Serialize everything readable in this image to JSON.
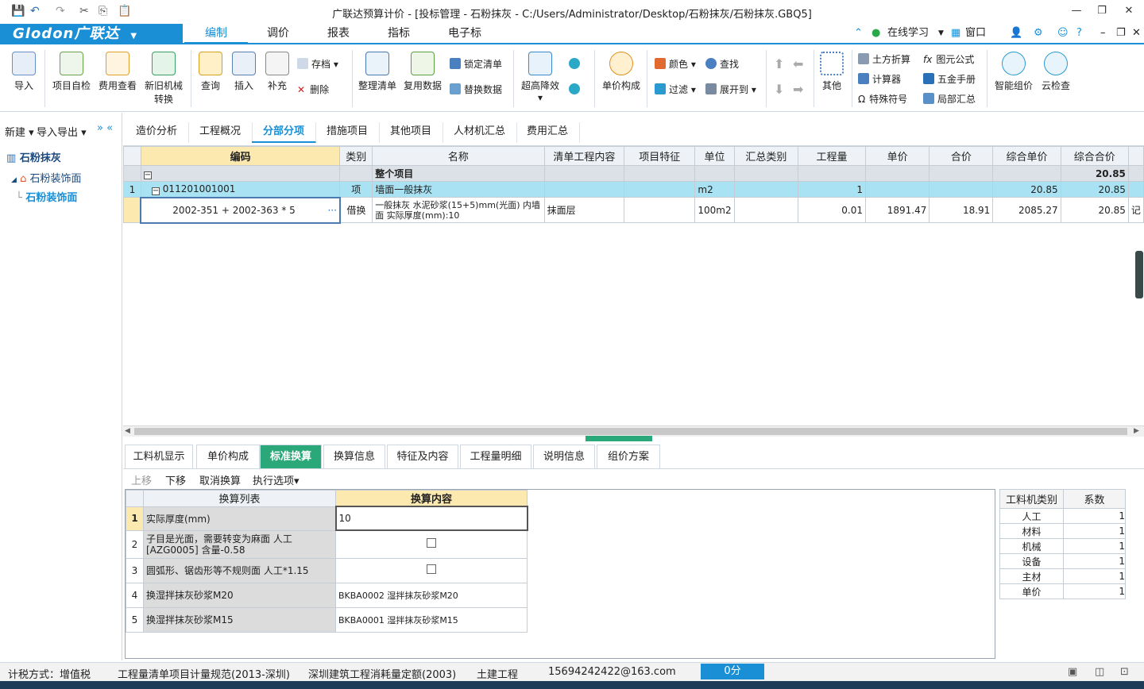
{
  "window": {
    "title": "广联达预算计价 - [投标管理 - 石粉抹灰 - C:/Users/Administrator/Desktop/石粉抹灰/石粉抹灰.GBQ5]",
    "minimize": "—",
    "restore": "❐",
    "close": "✕"
  },
  "menu": {
    "logo": "Glodon广联达",
    "tabs": [
      "编制",
      "调价",
      "报表",
      "指标",
      "电子标"
    ],
    "online_learning": "在线学习",
    "window": "窗口"
  },
  "ribbon": {
    "import": "导入",
    "project_check": "项目自检",
    "fee_view": "费用查看",
    "convert_line1": "新旧机械",
    "convert_line2": "转换",
    "query": "查询",
    "insert": "插入",
    "supplement": "补充",
    "archive": "存档",
    "delete": "删除",
    "organize": "整理清单",
    "reuse": "复用数据",
    "lock_list": "锁定清单",
    "replace_data": "替换数据",
    "height_cost": "超高降效",
    "unit_price": "单价构成",
    "color": "颜色",
    "find": "查找",
    "filter": "过滤",
    "expand": "展开到",
    "other": "其他",
    "earthwork": "土方折算",
    "graph_formula": "图元公式",
    "calculator": "计算器",
    "hardware_manual": "五金手册",
    "special_symbol": "特殊符号",
    "partial_summary": "局部汇总",
    "smart_pricing": "智能组价",
    "cloud_check": "云检查"
  },
  "left_panel": {
    "new": "新建",
    "import_export": "导入导出",
    "root": "石粉抹灰",
    "child": "石粉装饰面",
    "leaf": "石粉装饰面"
  },
  "content_tabs": [
    "造价分析",
    "工程概况",
    "分部分项",
    "措施项目",
    "其他项目",
    "人材机汇总",
    "费用汇总"
  ],
  "grid": {
    "headers": [
      "编码",
      "类别",
      "名称",
      "清单工程内容",
      "项目特征",
      "单位",
      "汇总类别",
      "工程量",
      "单价",
      "合价",
      "综合单价",
      "综合合价"
    ],
    "project_row": {
      "name": "整个项目",
      "total": "20.85"
    },
    "item_row": {
      "no": "1",
      "code": "011201001001",
      "type": "项",
      "name": "墙面一般抹灰",
      "unit": "m2",
      "qty": "1",
      "unit_total": "20.85",
      "total": "20.85"
    },
    "sub_row": {
      "code": "2002-351 + 2002-363 * 5",
      "more": "···",
      "type": "借换",
      "name_line1": "一般抹灰 水泥砂浆(15+5)mm(光面) 内墙",
      "name_line2": "面  实际厚度(mm):10",
      "content": "抹面层",
      "unit": "100m2",
      "qty": "0.01",
      "price": "1891.47",
      "amount": "18.91",
      "unit_total": "2085.27",
      "total": "20.85",
      "extra": "记"
    }
  },
  "bottom_tabs": [
    "工料机显示",
    "单价构成",
    "标准换算",
    "换算信息",
    "特征及内容",
    "工程量明细",
    "说明信息",
    "组价方案"
  ],
  "bottom_toolbar": {
    "up": "上移",
    "down": "下移",
    "cancel": "取消换算",
    "options": "执行选项"
  },
  "conversion": {
    "headers": [
      "换算列表",
      "换算内容"
    ],
    "rows": [
      {
        "no": "1",
        "item": "实际厚度(mm)",
        "value": "10"
      },
      {
        "no": "2",
        "item_line1": "子目是光面，需要转变为麻面 人工",
        "item_line2": "[AZG0005] 含量-0.58"
      },
      {
        "no": "3",
        "item": "圆弧形、锯齿形等不规则面 人工*1.15"
      },
      {
        "no": "4",
        "item": "换湿拌抹灰砂浆M20",
        "value": "BKBA0002  湿拌抹灰砂浆M20"
      },
      {
        "no": "5",
        "item": "换湿拌抹灰砂浆M15",
        "value": "BKBA0001  湿拌抹灰砂浆M15"
      }
    ]
  },
  "factors": {
    "headers": [
      "工料机类别",
      "系数"
    ],
    "rows": [
      {
        "type": "人工",
        "value": "1"
      },
      {
        "type": "材料",
        "value": "1"
      },
      {
        "type": "机械",
        "value": "1"
      },
      {
        "type": "设备",
        "value": "1"
      },
      {
        "type": "主材",
        "value": "1"
      },
      {
        "type": "单价",
        "value": "1"
      }
    ]
  },
  "status": {
    "tax": "计税方式：增值税",
    "spec": "工程量清单项目计量规范(2013-深圳)",
    "quota": "深圳建筑工程消耗量定额(2003)",
    "discipline": "土建工程",
    "user": "15694242422@163.com",
    "score": "0分"
  },
  "colors": {
    "accent": "#1a8fd6",
    "selected_row": "#a8e2f3",
    "active_bottom_tab": "#2aa87a",
    "header_highlight": "#fbe9b0"
  }
}
